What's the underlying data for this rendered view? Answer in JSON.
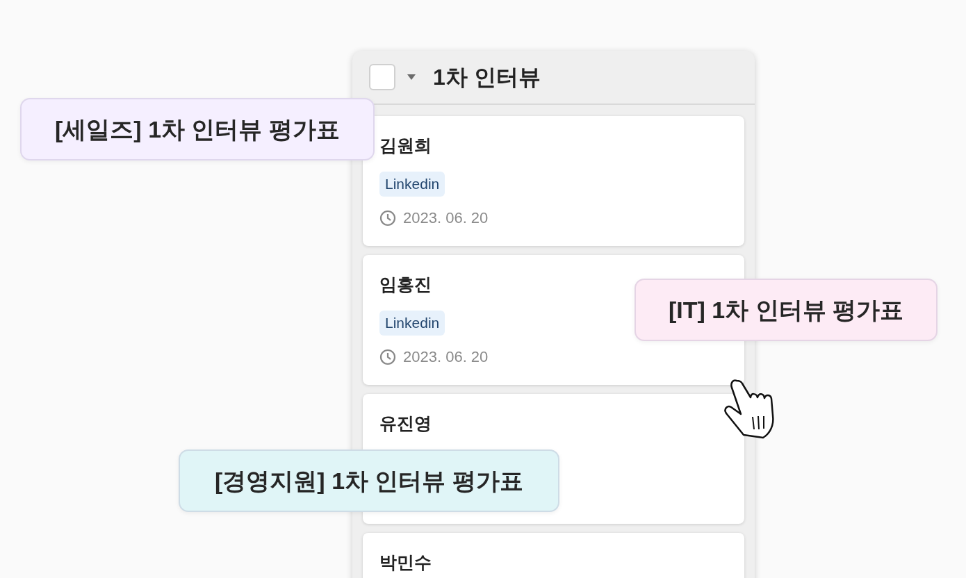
{
  "column": {
    "title": "1차 인터뷰",
    "checked": false,
    "cards": [
      {
        "name": "김원희",
        "tag": "Linkedin",
        "date": "2023. 06. 20"
      },
      {
        "name": "임홍진",
        "tag": "Linkedin",
        "date": "2023. 06. 20"
      },
      {
        "name": "유진영"
      },
      {
        "name": "박민수"
      }
    ]
  },
  "floating_labels": [
    {
      "text": "[세일즈] 1차 인터뷰 평가표",
      "color": "#f5efff"
    },
    {
      "text": "[IT] 1차 인터뷰 평가표",
      "color": "#fdebf5"
    },
    {
      "text": "[경영지원] 1차 인터뷰 평가표",
      "color": "#e0f5f7"
    }
  ]
}
